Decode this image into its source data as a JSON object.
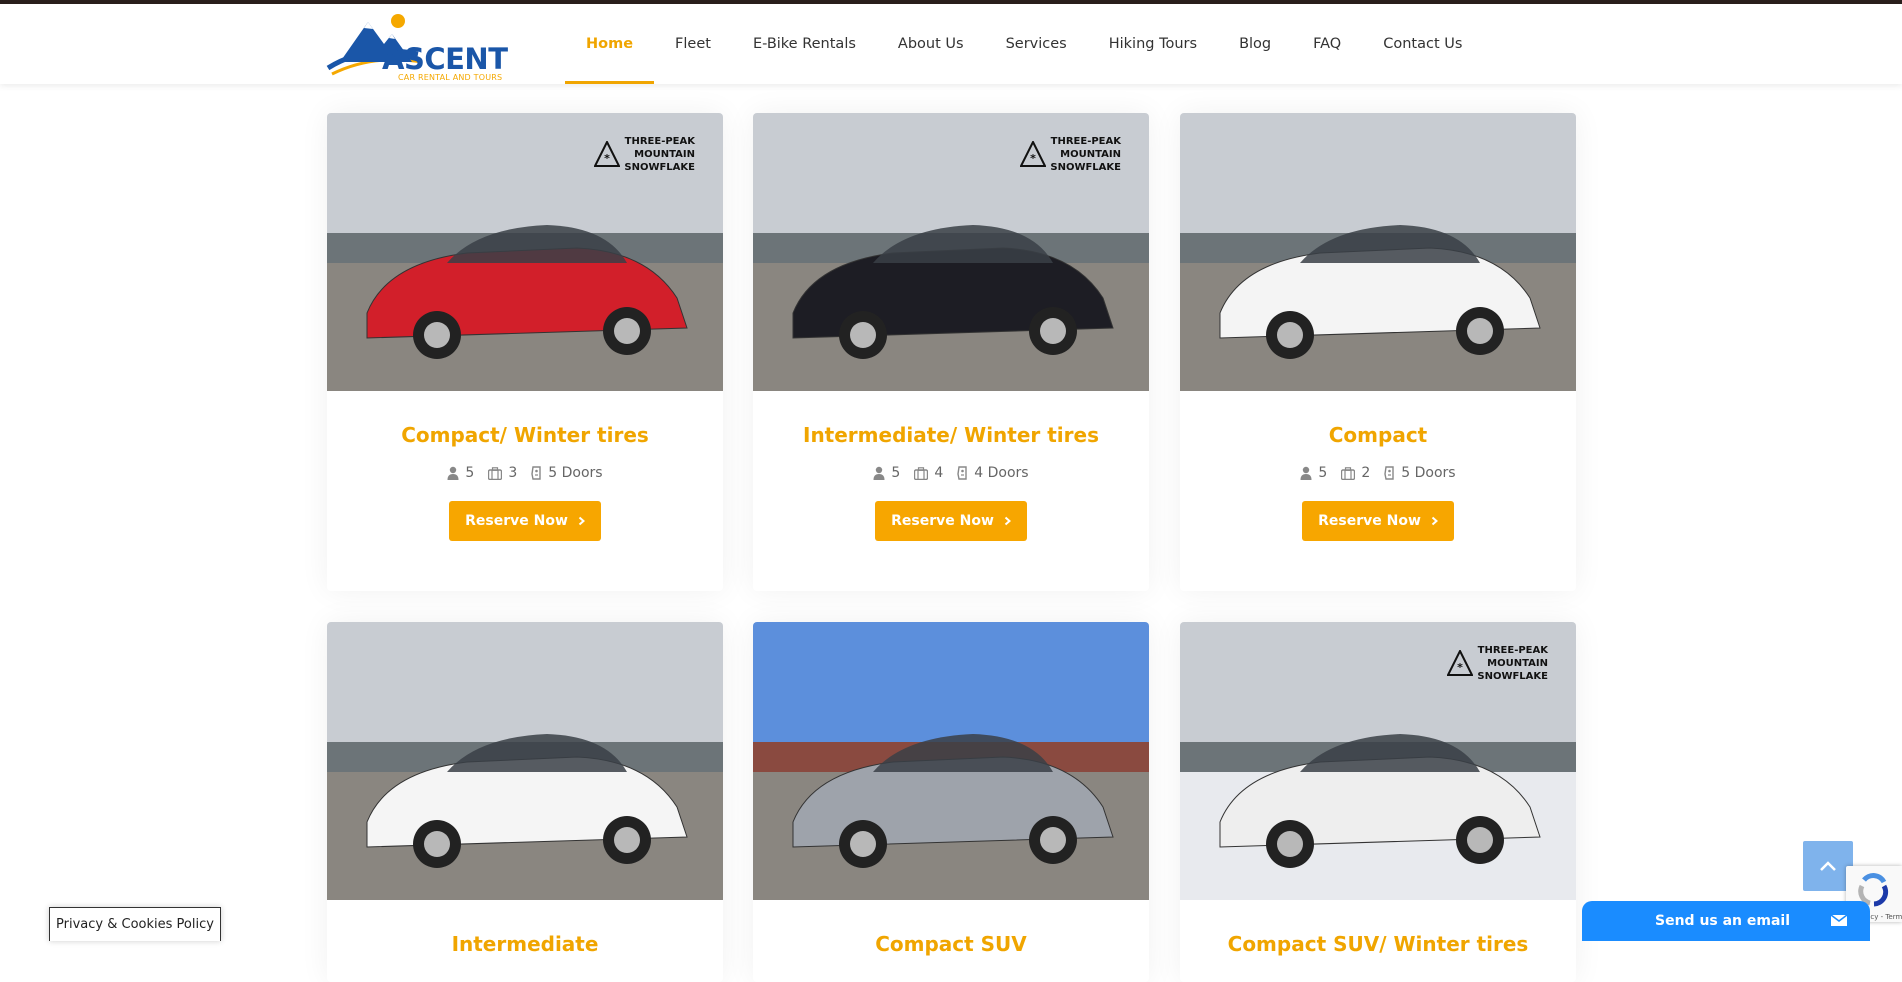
{
  "brand": {
    "name": "ASCENT",
    "tagline": "CAR RENTAL AND TOURS",
    "accent": "#f0a500",
    "blue": "#1a56a8"
  },
  "nav": [
    {
      "label": "Home",
      "active": true
    },
    {
      "label": "Fleet"
    },
    {
      "label": "E-Bike Rentals"
    },
    {
      "label": "About Us"
    },
    {
      "label": "Services"
    },
    {
      "label": "Hiking Tours"
    },
    {
      "label": "Blog"
    },
    {
      "label": "FAQ"
    },
    {
      "label": "Contact Us"
    }
  ],
  "badge": {
    "line1": "THREE-PEAK",
    "line2": "MOUNTAIN",
    "line3": "SNOWFLAKE"
  },
  "cards": [
    {
      "title": "Compact/ Winter tires",
      "passengers": "5",
      "bags": "3",
      "doors": "5 Doors",
      "button": "Reserve Now",
      "car_color": "#d21f2a",
      "badge": true
    },
    {
      "title": "Intermediate/ Winter tires",
      "passengers": "5",
      "bags": "4",
      "doors": "4 Doors",
      "button": "Reserve Now",
      "car_color": "#1d1d24",
      "badge": true
    },
    {
      "title": "Compact",
      "passengers": "5",
      "bags": "2",
      "doors": "5 Doors",
      "button": "Reserve Now",
      "car_color": "#f4f4f4",
      "badge": false
    },
    {
      "title": "Intermediate",
      "car_color": "#f5f5f5",
      "badge": false
    },
    {
      "title": "Compact SUV",
      "car_color": "#9ea3ab",
      "badge": false
    },
    {
      "title": "Compact SUV/ Winter tires",
      "car_color": "#eeeeee",
      "badge": true
    }
  ],
  "privacy_label": "Privacy & Cookies Policy",
  "email_label": "Send us an email",
  "recaptcha_terms": "ivacy - Terms"
}
